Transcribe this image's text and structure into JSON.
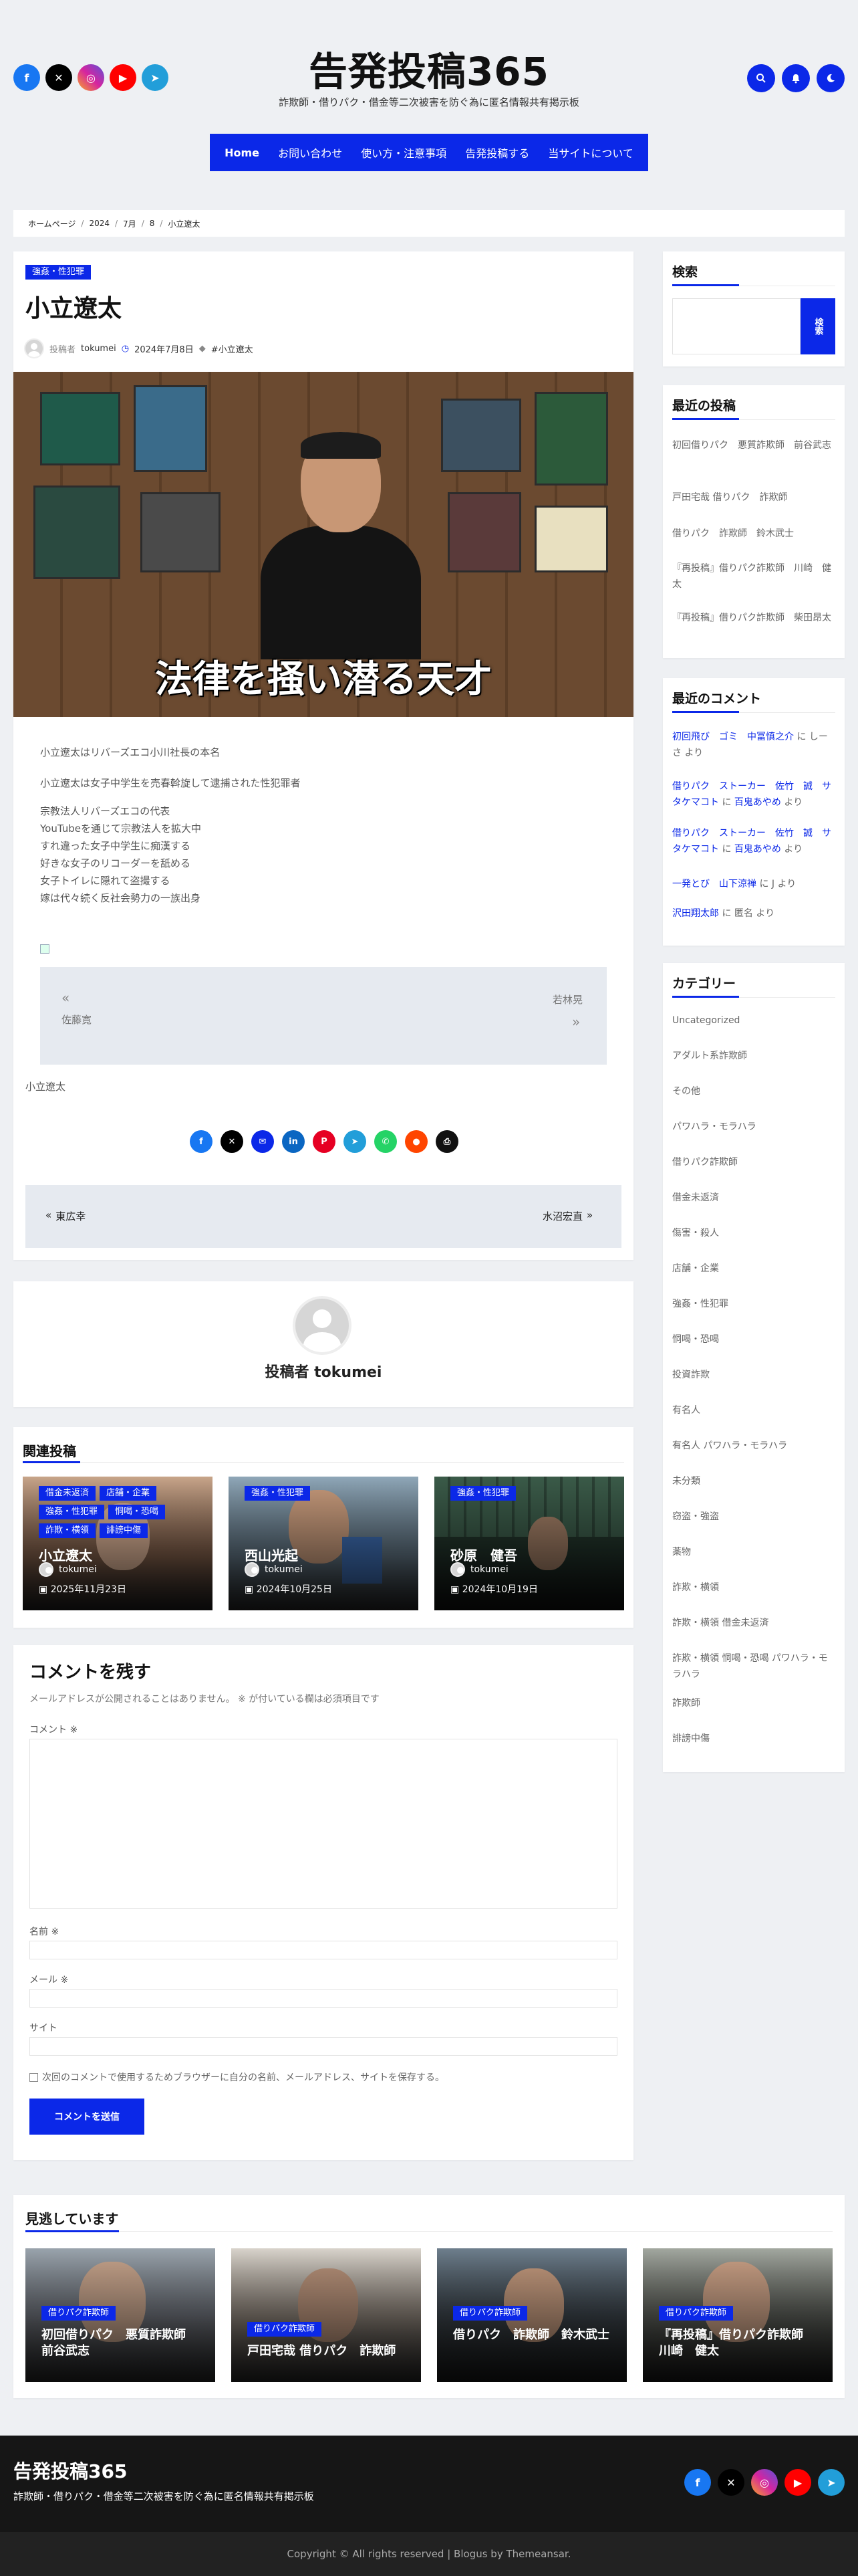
{
  "site": {
    "title": "告発投稿365",
    "tagline": "詐欺師・借りパク・借金等二次被害を防ぐ為に匿名情報共有掲示板"
  },
  "nav": [
    "Home",
    "お問い合わせ",
    "使い方・注意事項",
    "告発投稿する",
    "当サイトについて"
  ],
  "breadcrumb": [
    "ホームページ",
    "2024",
    "7月",
    "8",
    "小立遼太"
  ],
  "post": {
    "category": "強姦・性犯罪",
    "title": "小立遼太",
    "author_prefix": "投稿者",
    "author": "tokumei",
    "date": "2024年7月8日",
    "tag": "#小立遼太",
    "image_caption": "法律を掻い潜る天才",
    "lines_a": [
      "小立遼太はリバーズエコ小川社長の本名"
    ],
    "lines_b": [
      "小立遼太は女子中学生を売春斡旋して逮捕された性犯罪者"
    ],
    "lines_c": [
      "宗教法人リバーズエコの代表",
      "YouTubeを通じて宗教法人を拡大中",
      "すれ違った女子中学生に痴漢する",
      "好きな女子のリコーダーを舐める",
      "女子トイレに隠れて盗撮する",
      "嫁は代々続く反社会勢力の一族出身"
    ],
    "inner_prev": "佐藤寛",
    "inner_next": "若林晃",
    "tag_text": "小立遼太",
    "prev_post": "東広幸",
    "next_post": "水沼宏直"
  },
  "author_box": {
    "label": "投稿者 tokumei"
  },
  "related": {
    "heading": "関連投稿",
    "items": [
      {
        "tags": [
          "借金未返済",
          "店舗・企業",
          "強姦・性犯罪",
          "恫喝・恐喝",
          "詐欺・横領",
          "誹謗中傷"
        ],
        "title": "小立遼太",
        "author": "tokumei",
        "date": "2025年11月23日"
      },
      {
        "tags": [
          "強姦・性犯罪"
        ],
        "title": "西山光起",
        "author": "tokumei",
        "date": "2024年10月25日"
      },
      {
        "tags": [
          "強姦・性犯罪"
        ],
        "title": "砂原　健吾",
        "author": "tokumei",
        "date": "2024年10月19日"
      }
    ]
  },
  "comment_form": {
    "heading": "コメントを残す",
    "notice": "メールアドレスが公開されることはありません。 ※ が付いている欄は必須項目です",
    "comment_label": "コメント ※",
    "name_label": "名前 ※",
    "email_label": "メール ※",
    "site_label": "サイト",
    "save_label": "次回のコメントで使用するためブラウザーに自分の名前、メールアドレス、サイトを保存する。",
    "submit": "コメントを送信"
  },
  "sidebar": {
    "search_heading": "検索",
    "search_button": "検索",
    "recent_heading": "最近の投稿",
    "recent": [
      "初回借りパク　悪質詐欺師　前谷武志",
      "戸田宅哉 借りパク　詐欺師",
      "借りパク　詐欺師　鈴木武士",
      "『再投稿』借りパク詐欺師　川崎　健太",
      "『再投稿』借りパク詐欺師　柴田昂太"
    ],
    "comments_heading": "最近のコメント",
    "comments": [
      {
        "who": "初回飛び　ゴミ　中冨慎之介",
        "on": "しーさ"
      },
      {
        "who": "借りパク　ストーカー　佐竹　誠　サタケマコト",
        "on": "百鬼あやめ"
      },
      {
        "who": "借りパク　ストーカー　佐竹　誠　サタケマコト",
        "on": "百鬼あやめ"
      },
      {
        "who": "一発とび　山下涼禅",
        "on": "J"
      },
      {
        "who": "沢田翔太郎",
        "on": "匿名"
      }
    ],
    "comment_joiner": "に",
    "comment_suffix": "より",
    "categories_heading": "カテゴリー",
    "categories": [
      "Uncategorized",
      "アダルト系詐欺師",
      "その他",
      "パワハラ・モラハラ",
      "借りパク詐欺師",
      "借金未返済",
      "傷害・殺人",
      "店舗・企業",
      "強姦・性犯罪",
      "恫喝・恐喝",
      "投資詐欺",
      "有名人",
      "有名人 パワハラ・モラハラ",
      "未分類",
      "窃盗・強盗",
      "薬物",
      "詐欺・横領",
      "詐欺・横領 借金未返済",
      "詐欺・横領 恫喝・恐喝 パワハラ・モラハラ",
      "詐欺師",
      "誹謗中傷"
    ]
  },
  "missed": {
    "heading": "見逃しています",
    "items": [
      {
        "tag": "借りパク詐欺師",
        "title": "初回借りパク　悪質詐欺師　前谷武志"
      },
      {
        "tag": "借りパク詐欺師",
        "title": "戸田宅哉 借りパク　詐欺師"
      },
      {
        "tag": "借りパク詐欺師",
        "title": "借りパク　詐欺師　鈴木武士"
      },
      {
        "tag": "借りパク詐欺師",
        "title": "『再投稿』借りパク詐欺師　川崎　健太"
      }
    ]
  },
  "footer": {
    "title": "告発投稿365",
    "tagline": "詐欺師・借りパク・借金等二次被害を防ぐ為に匿名情報共有掲示板",
    "copyright": "Copyright © All rights reserved | Blogus by Themeansar."
  },
  "colors": {
    "accent": "#0b28e8",
    "facebook": "#1877f2",
    "x": "#000000",
    "instagram": "#d6249f",
    "youtube": "#ff0000",
    "telegram": "#229ed9"
  }
}
